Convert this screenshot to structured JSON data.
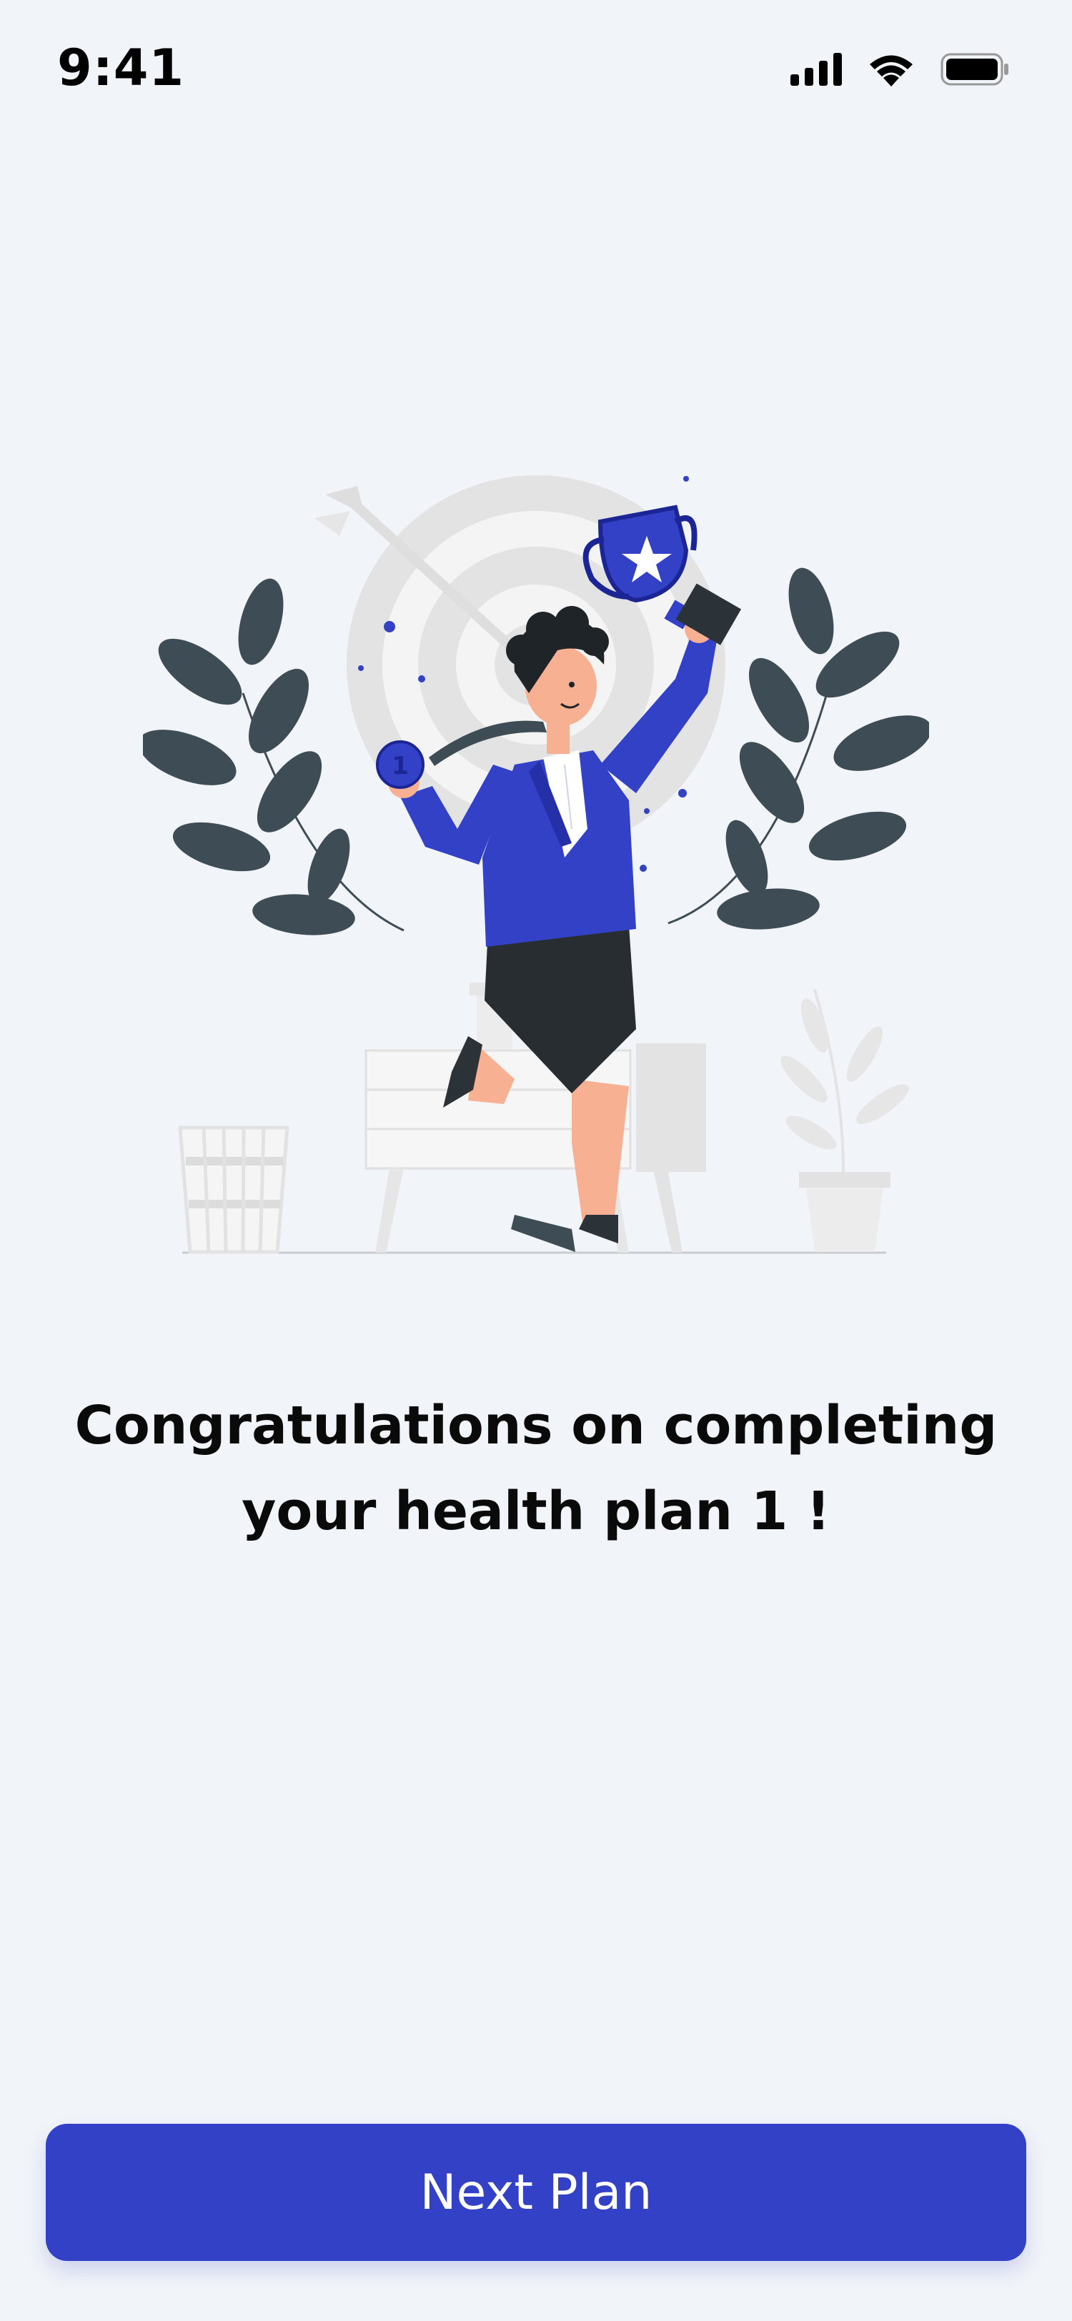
{
  "status_bar": {
    "time": "9:41",
    "icons": [
      "cellular-signal-icon",
      "wifi-icon",
      "battery-icon"
    ]
  },
  "illustration": {
    "subject": "celebration-illustration",
    "medal_number": "1"
  },
  "content": {
    "headline_line1": "Congratulations on completing",
    "headline_line2": "your health plan 1 !"
  },
  "actions": {
    "primary_label": "Next Plan"
  },
  "colors": {
    "background": "#f1f4f8",
    "accent": "#3241c5",
    "leaf": "#3e4c56",
    "text": "#0a0a0a"
  }
}
